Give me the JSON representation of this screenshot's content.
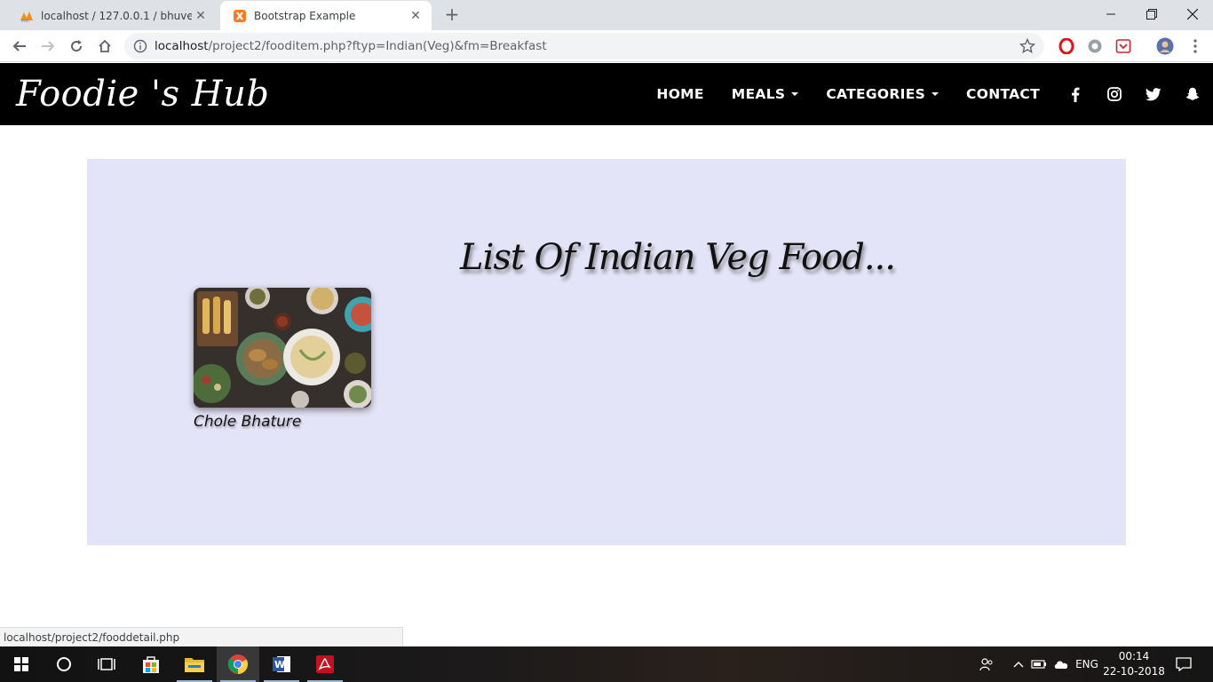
{
  "browser": {
    "tabs": [
      {
        "title": "localhost / 127.0.0.1 / bhuvesh20",
        "active": false
      },
      {
        "title": "Bootstrap Example",
        "active": true
      }
    ],
    "url_host": "localhost",
    "url_path": "/project2/fooditem.php?ftyp=Indian(Veg)&fm=Breakfast",
    "status_url": "localhost/project2/fooddetail.php"
  },
  "site": {
    "brand": "Foodie 's Hub",
    "nav": [
      {
        "label": "HOME",
        "dropdown": false
      },
      {
        "label": "MEALS",
        "dropdown": true
      },
      {
        "label": "CATEGORIES",
        "dropdown": true
      },
      {
        "label": "CONTACT",
        "dropdown": false
      }
    ],
    "social": [
      "facebook-icon",
      "instagram-icon",
      "twitter-icon",
      "snapchat-icon"
    ],
    "heading": "List Of Indian Veg Food...",
    "items": [
      {
        "name": "Chole Bhature"
      }
    ]
  },
  "taskbar": {
    "language": "ENG",
    "time": "00:14",
    "date": "22-10-2018"
  },
  "colors": {
    "navbar_bg": "#000000",
    "panel_bg": "#e4e4f8",
    "tabstrip_bg": "#dee1e6"
  }
}
